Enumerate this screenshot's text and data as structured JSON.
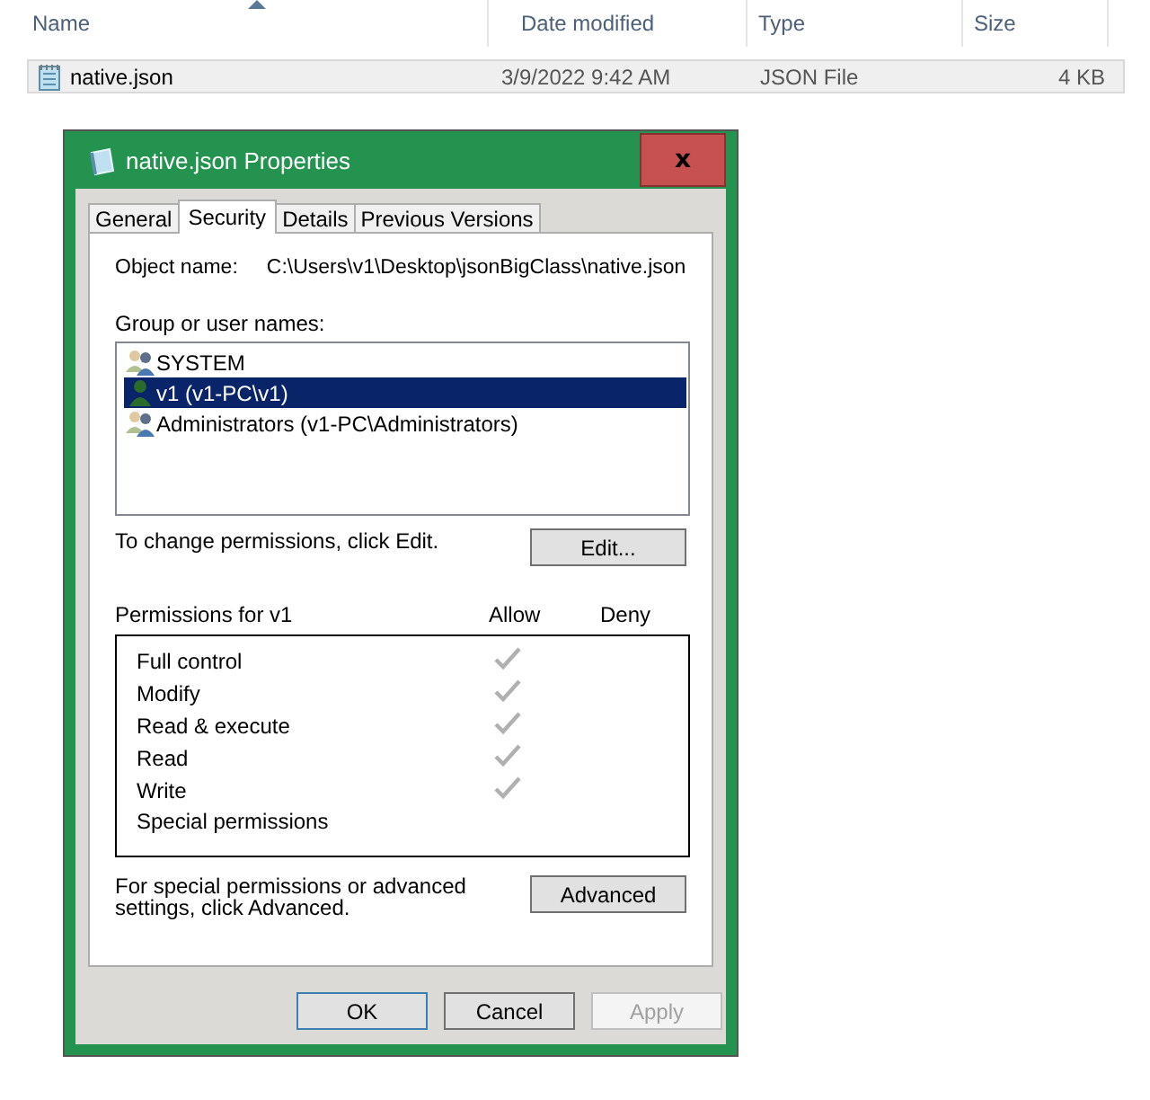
{
  "explorer": {
    "columns": [
      {
        "label": "Name",
        "sorted": true
      },
      {
        "label": "Date modified",
        "sorted": false
      },
      {
        "label": "Type",
        "sorted": false
      },
      {
        "label": "Size",
        "sorted": false
      }
    ],
    "files": [
      {
        "name": "native.json",
        "date": "3/9/2022 9:42 AM",
        "type": "JSON File",
        "size": "4 KB",
        "selected": true
      }
    ]
  },
  "dialog": {
    "title": "native.json Properties",
    "close": "x",
    "tabs": [
      {
        "label": "General",
        "selected": false
      },
      {
        "label": "Security",
        "selected": true
      },
      {
        "label": "Details",
        "selected": false
      },
      {
        "label": "Previous Versions",
        "selected": false
      }
    ],
    "object_label": "Object name:",
    "object_value": "C:\\Users\\v1\\Desktop\\jsonBigClass\\native.json",
    "group_label": "Group or user names:",
    "users": [
      {
        "name": "SYSTEM",
        "kind": "group",
        "selected": false
      },
      {
        "name": "v1 (v1-PC\\v1)",
        "kind": "user",
        "selected": true
      },
      {
        "name": "Administrators (v1-PC\\Administrators)",
        "kind": "group",
        "selected": false
      }
    ],
    "edit_hint": "To change permissions, click Edit.",
    "edit_button": "Edit...",
    "permissions_label": "Permissions for v1",
    "allow_label": "Allow",
    "deny_label": "Deny",
    "permissions": [
      {
        "name": "Full control",
        "allow": true,
        "deny": false
      },
      {
        "name": "Modify",
        "allow": true,
        "deny": false
      },
      {
        "name": "Read & execute",
        "allow": true,
        "deny": false
      },
      {
        "name": "Read",
        "allow": true,
        "deny": false
      },
      {
        "name": "Write",
        "allow": true,
        "deny": false
      },
      {
        "name": "Special permissions",
        "allow": false,
        "deny": false
      }
    ],
    "advanced_hint": "For special permissions or advanced settings, click Advanced.",
    "advanced_button": "Advanced",
    "buttons": [
      {
        "label": "OK",
        "disabled": false,
        "default": true
      },
      {
        "label": "Cancel",
        "disabled": false,
        "default": false
      },
      {
        "label": "Apply",
        "disabled": true,
        "default": false
      }
    ]
  }
}
